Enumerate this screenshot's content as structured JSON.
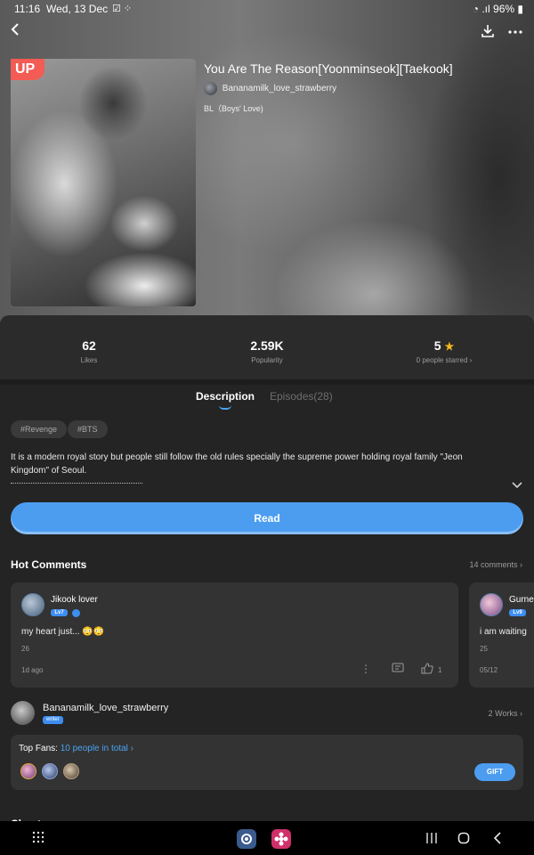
{
  "status_bar": {
    "time": "11:16",
    "date": "Wed, 13 Dec",
    "battery": "96%"
  },
  "header": {
    "back_icon": "back-arrow-icon",
    "download_icon": "download-icon",
    "more_icon": "more-icon"
  },
  "book": {
    "badge": "UP",
    "title": "You Are The Reason[Yoonminseok][Taekook]",
    "author": "Bananamilk_love_strawberry",
    "genre": "BL（Boys' Love)"
  },
  "stats": [
    {
      "value": "62",
      "label": "Likes"
    },
    {
      "value": "2.59K",
      "label": "Popularity"
    },
    {
      "value": "5",
      "label": "0 people starred ›"
    }
  ],
  "tabs": {
    "description": "Description",
    "episodes": "Episodes(28)"
  },
  "tags": [
    "#Revenge",
    "#BTS"
  ],
  "description": "It is a modern royal story but people still follow the old rules specially the supreme power holding royal family \"Jeon Kingdom\" of Seoul.",
  "read_button": "Read",
  "comments": {
    "title": "Hot Comments",
    "count": "14 comments",
    "items": [
      {
        "user": "Jikook lover",
        "level": "Lv7",
        "text": "my heart just... 😳😳",
        "likes": "26",
        "time": "1d ago",
        "like_count": "1"
      },
      {
        "user": "Gurne",
        "level": "Lv9",
        "text": "i am waiting",
        "likes": "25",
        "time": "05/12"
      }
    ]
  },
  "author_section": {
    "name": "Bananamilk_love_strawberry",
    "badge": "writer",
    "works": "2 Works"
  },
  "fans": {
    "label": "Top Fans:",
    "link": "10 people in total",
    "gift_button": "GIFT"
  },
  "next_section": "Chapters",
  "colors": {
    "accent": "#4c9df0",
    "badge_red": "#f25c54",
    "star": "#f5b81d",
    "background": "#242424"
  }
}
